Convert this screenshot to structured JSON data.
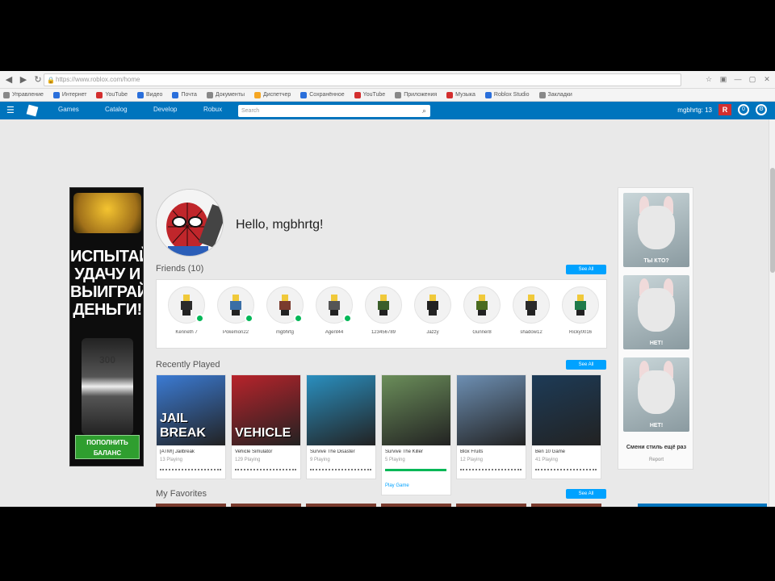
{
  "browser": {
    "url": "https://www.roblox.com/home",
    "bookmarks": [
      {
        "label": "Управление",
        "color": "#888888"
      },
      {
        "label": "Интернет",
        "color": "#2a6fdb"
      },
      {
        "label": "YouTube",
        "color": "#d32f2f"
      },
      {
        "label": "Видео",
        "color": "#2a6fdb"
      },
      {
        "label": "Почта",
        "color": "#2a6fdb"
      },
      {
        "label": "Документы",
        "color": "#888888"
      },
      {
        "label": "Диспетчер",
        "color": "#f5a623"
      },
      {
        "label": "Сохранённое",
        "color": "#2a6fdb"
      },
      {
        "label": "YouTube",
        "color": "#d32f2f"
      },
      {
        "label": "Приложения",
        "color": "#888888"
      },
      {
        "label": "Музыка",
        "color": "#d32f2f"
      },
      {
        "label": "Roblox Studio",
        "color": "#2a6fdb"
      },
      {
        "label": "Закладки",
        "color": "#888888"
      }
    ]
  },
  "topnav": {
    "links": [
      "Games",
      "Catalog",
      "Develop",
      "Robux"
    ],
    "search_placeholder": "Search",
    "username": "mgbhrtg: 13",
    "robux_badge": "R",
    "notif_count": "0"
  },
  "left_ad": {
    "headline": "ИСПЫТАЙ УДАЧУ И ВЫИГРАЙ ДЕНЬГИ!",
    "chip_text": "300",
    "cta": "ПОПОЛНИТЬ БАЛАНС"
  },
  "right_ad": {
    "captions": [
      "ТЫ КТО?",
      "НЕТ!",
      "НЕТ!"
    ],
    "footer": "Смени стиль ещё раз",
    "footer_sub": "Report"
  },
  "greeting": "Hello, mgbhrtg!",
  "friends": {
    "title": "Friends (10)",
    "see_all": "See All",
    "items": [
      {
        "name": "Kenneth 7",
        "online": true,
        "shirt": "#2b2b2b"
      },
      {
        "name": "Pokemon22",
        "online": true,
        "shirt": "#3a6ea5"
      },
      {
        "name": "mgbhrtg",
        "online": true,
        "shirt": "#7a3b2e"
      },
      {
        "name": "Agent44",
        "online": true,
        "shirt": "#555555"
      },
      {
        "name": "123456789",
        "online": false,
        "shirt": "#3b5e2b"
      },
      {
        "name": "Jazzy",
        "online": false,
        "shirt": "#222222"
      },
      {
        "name": "Gunner8",
        "online": false,
        "shirt": "#4a6b1f"
      },
      {
        "name": "shadow12",
        "online": false,
        "shirt": "#2b2b2b"
      },
      {
        "name": "Ricky0016",
        "online": false,
        "shirt": "#1f7a4a"
      }
    ]
  },
  "recently_played": {
    "title": "Recently Played",
    "see_all": "See All",
    "games": [
      {
        "title": "[ATM!] Jailbreak",
        "sub": "13 Playing",
        "thumb_text": "JAIL BREAK",
        "bg": "#3b7bd4",
        "expanded": false
      },
      {
        "title": "Vehicle Simulator",
        "sub": "129 Playing",
        "thumb_text": "VEHICLE",
        "bg": "#b8232b",
        "expanded": false
      },
      {
        "title": "Survive The Disaster",
        "sub": "9 Playing",
        "thumb_text": "",
        "bg": "#2a8fbf",
        "expanded": false
      },
      {
        "title": "Survive The Killer",
        "sub": "5 Playing",
        "thumb_text": "",
        "bg": "#6b8e5a",
        "expanded": true,
        "link": "Play Game"
      },
      {
        "title": "Blox Fruits",
        "sub": "12 Playing",
        "thumb_text": "",
        "bg": "#6d8fb3",
        "expanded": false
      },
      {
        "title": "Ben 10 Game",
        "sub": "41 Playing",
        "thumb_text": "",
        "bg": "#1d3b57",
        "expanded": false
      }
    ]
  },
  "favorites": {
    "title": "My Favorites",
    "see_all": "See All"
  }
}
